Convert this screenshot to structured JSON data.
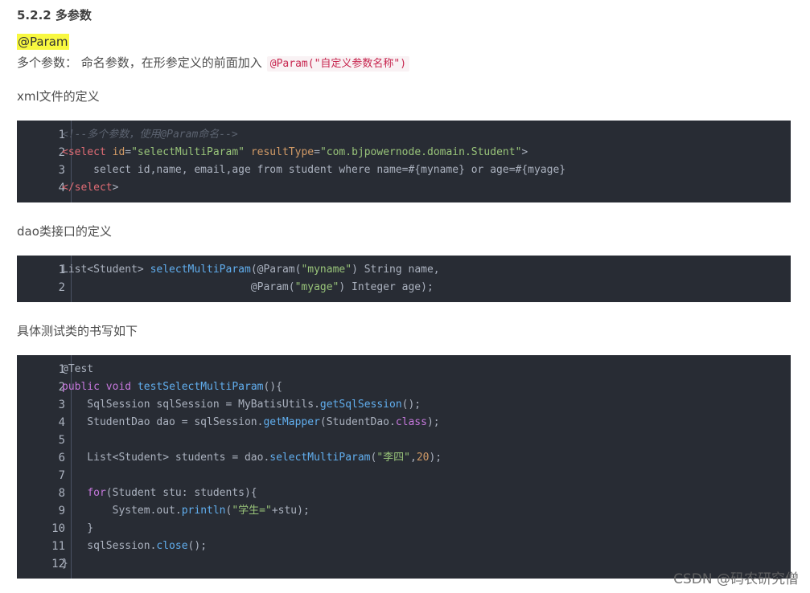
{
  "heading": "5.2.2 多参数",
  "mark": "@Param",
  "intro": {
    "text": "多个参数： 命名参数，在形参定义的前面加入",
    "code": "@Param(\"自定义参数名称\")"
  },
  "xml_label": "xml文件的定义",
  "dao_label": "dao类接口的定义",
  "test_label": "具体测试类的书写如下",
  "watermark": "CSDN @码农研究僧",
  "code_xml": [
    {
      "n": "1",
      "tokens": [
        {
          "c": "t-comment",
          "t": "<!--多个参数，使用@Param命名-->"
        }
      ]
    },
    {
      "n": "2",
      "tokens": [
        {
          "c": "t-tag",
          "t": "<select"
        },
        {
          "c": "t-plain",
          "t": " "
        },
        {
          "c": "t-attr",
          "t": "id"
        },
        {
          "c": "t-plain",
          "t": "="
        },
        {
          "c": "t-str",
          "t": "\"selectMultiParam\""
        },
        {
          "c": "t-plain",
          "t": " "
        },
        {
          "c": "t-attr",
          "t": "resultType"
        },
        {
          "c": "t-plain",
          "t": "="
        },
        {
          "c": "t-str",
          "t": "\"com.bjpowernode.domain.Student\""
        },
        {
          "c": "t-plain",
          "t": ">"
        }
      ]
    },
    {
      "n": "3",
      "tokens": [
        {
          "c": "t-plain",
          "t": "     select id,name, email,age from student where name=#{myname} or age=#{myage}"
        }
      ]
    },
    {
      "n": "4",
      "tokens": [
        {
          "c": "t-tag",
          "t": "</select"
        },
        {
          "c": "t-plain",
          "t": ">"
        }
      ]
    }
  ],
  "code_dao": [
    {
      "n": "1",
      "tokens": [
        {
          "c": "t-plain",
          "t": "List<Student> "
        },
        {
          "c": "t-fn",
          "t": "selectMultiParam"
        },
        {
          "c": "t-plain",
          "t": "(@Param("
        },
        {
          "c": "t-str",
          "t": "\"myname\""
        },
        {
          "c": "t-plain",
          "t": ") String name,"
        }
      ]
    },
    {
      "n": "2",
      "tokens": [
        {
          "c": "t-plain",
          "t": "                              @Param("
        },
        {
          "c": "t-str",
          "t": "\"myage\""
        },
        {
          "c": "t-plain",
          "t": ") Integer age);"
        }
      ]
    }
  ],
  "code_test": [
    {
      "n": "1",
      "tokens": [
        {
          "c": "t-anno",
          "t": "@Test"
        }
      ]
    },
    {
      "n": "2",
      "tokens": [
        {
          "c": "t-kw",
          "t": "public"
        },
        {
          "c": "t-plain",
          "t": " "
        },
        {
          "c": "t-kw",
          "t": "void"
        },
        {
          "c": "t-plain",
          "t": " "
        },
        {
          "c": "t-fn",
          "t": "testSelectMultiParam"
        },
        {
          "c": "t-plain",
          "t": "(){"
        }
      ]
    },
    {
      "n": "3",
      "tokens": [
        {
          "c": "t-plain",
          "t": "    SqlSession sqlSession = MyBatisUtils."
        },
        {
          "c": "t-fn",
          "t": "getSqlSession"
        },
        {
          "c": "t-plain",
          "t": "();"
        }
      ]
    },
    {
      "n": "4",
      "tokens": [
        {
          "c": "t-plain",
          "t": "    StudentDao dao = sqlSession."
        },
        {
          "c": "t-fn",
          "t": "getMapper"
        },
        {
          "c": "t-plain",
          "t": "(StudentDao."
        },
        {
          "c": "t-kw",
          "t": "class"
        },
        {
          "c": "t-plain",
          "t": ");"
        }
      ]
    },
    {
      "n": "5",
      "tokens": [
        {
          "c": "t-plain",
          "t": ""
        }
      ]
    },
    {
      "n": "6",
      "tokens": [
        {
          "c": "t-plain",
          "t": "    List<Student> students = dao."
        },
        {
          "c": "t-fn",
          "t": "selectMultiParam"
        },
        {
          "c": "t-plain",
          "t": "("
        },
        {
          "c": "t-str",
          "t": "\"李四\""
        },
        {
          "c": "t-plain",
          "t": ","
        },
        {
          "c": "t-num",
          "t": "20"
        },
        {
          "c": "t-plain",
          "t": ");"
        }
      ]
    },
    {
      "n": "7",
      "tokens": [
        {
          "c": "t-plain",
          "t": ""
        }
      ]
    },
    {
      "n": "8",
      "tokens": [
        {
          "c": "t-plain",
          "t": "    "
        },
        {
          "c": "t-kw",
          "t": "for"
        },
        {
          "c": "t-plain",
          "t": "(Student stu: students){"
        }
      ]
    },
    {
      "n": "9",
      "tokens": [
        {
          "c": "t-plain",
          "t": "        System.out."
        },
        {
          "c": "t-fn",
          "t": "println"
        },
        {
          "c": "t-plain",
          "t": "("
        },
        {
          "c": "t-str",
          "t": "\"学生=\""
        },
        {
          "c": "t-plain",
          "t": "+stu);"
        }
      ]
    },
    {
      "n": "10",
      "tokens": [
        {
          "c": "t-plain",
          "t": "    }"
        }
      ]
    },
    {
      "n": "11",
      "tokens": [
        {
          "c": "t-plain",
          "t": "    sqlSession."
        },
        {
          "c": "t-fn",
          "t": "close"
        },
        {
          "c": "t-plain",
          "t": "();"
        }
      ]
    },
    {
      "n": "12",
      "tokens": [
        {
          "c": "t-plain",
          "t": "}"
        }
      ]
    }
  ]
}
